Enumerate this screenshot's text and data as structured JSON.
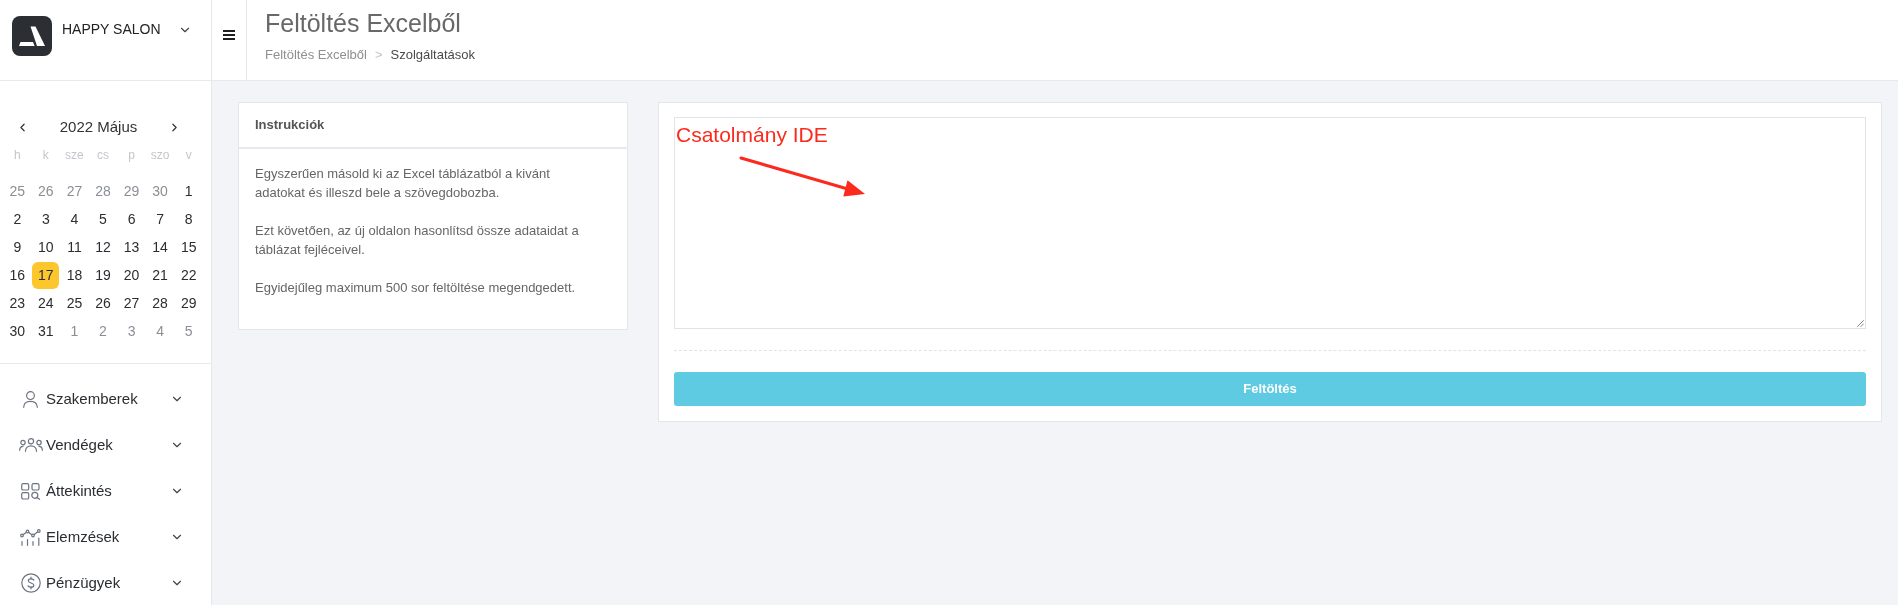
{
  "sidebar": {
    "brand": {
      "name": "HAPPY SALON"
    },
    "calendar": {
      "title": "2022 Május",
      "weekdays": [
        "h",
        "k",
        "sze",
        "cs",
        "p",
        "szo",
        "v"
      ],
      "weeks": [
        [
          {
            "day": "25",
            "outside": true,
            "selected": false
          },
          {
            "day": "26",
            "outside": true,
            "selected": false
          },
          {
            "day": "27",
            "outside": true,
            "selected": false
          },
          {
            "day": "28",
            "outside": true,
            "selected": false
          },
          {
            "day": "29",
            "outside": true,
            "selected": false
          },
          {
            "day": "30",
            "outside": true,
            "selected": false
          },
          {
            "day": "1",
            "outside": false,
            "selected": false
          }
        ],
        [
          {
            "day": "2",
            "outside": false,
            "selected": false
          },
          {
            "day": "3",
            "outside": false,
            "selected": false
          },
          {
            "day": "4",
            "outside": false,
            "selected": false
          },
          {
            "day": "5",
            "outside": false,
            "selected": false
          },
          {
            "day": "6",
            "outside": false,
            "selected": false
          },
          {
            "day": "7",
            "outside": false,
            "selected": false
          },
          {
            "day": "8",
            "outside": false,
            "selected": false
          }
        ],
        [
          {
            "day": "9",
            "outside": false,
            "selected": false
          },
          {
            "day": "10",
            "outside": false,
            "selected": false
          },
          {
            "day": "11",
            "outside": false,
            "selected": false
          },
          {
            "day": "12",
            "outside": false,
            "selected": false
          },
          {
            "day": "13",
            "outside": false,
            "selected": false
          },
          {
            "day": "14",
            "outside": false,
            "selected": false
          },
          {
            "day": "15",
            "outside": false,
            "selected": false
          }
        ],
        [
          {
            "day": "16",
            "outside": false,
            "selected": false
          },
          {
            "day": "17",
            "outside": false,
            "selected": true
          },
          {
            "day": "18",
            "outside": false,
            "selected": false
          },
          {
            "day": "19",
            "outside": false,
            "selected": false
          },
          {
            "day": "20",
            "outside": false,
            "selected": false
          },
          {
            "day": "21",
            "outside": false,
            "selected": false
          },
          {
            "day": "22",
            "outside": false,
            "selected": false
          }
        ],
        [
          {
            "day": "23",
            "outside": false,
            "selected": false
          },
          {
            "day": "24",
            "outside": false,
            "selected": false
          },
          {
            "day": "25",
            "outside": false,
            "selected": false
          },
          {
            "day": "26",
            "outside": false,
            "selected": false
          },
          {
            "day": "27",
            "outside": false,
            "selected": false
          },
          {
            "day": "28",
            "outside": false,
            "selected": false
          },
          {
            "day": "29",
            "outside": false,
            "selected": false
          }
        ],
        [
          {
            "day": "30",
            "outside": false,
            "selected": false
          },
          {
            "day": "31",
            "outside": false,
            "selected": false
          },
          {
            "day": "1",
            "outside": true,
            "selected": false
          },
          {
            "day": "2",
            "outside": true,
            "selected": false
          },
          {
            "day": "3",
            "outside": true,
            "selected": false
          },
          {
            "day": "4",
            "outside": true,
            "selected": false
          },
          {
            "day": "5",
            "outside": true,
            "selected": false
          }
        ]
      ]
    },
    "nav": [
      {
        "label": "Szakemberek",
        "expanded": false
      },
      {
        "label": "Vendégek",
        "expanded": false
      },
      {
        "label": "Áttekintés",
        "expanded": false
      },
      {
        "label": "Elemzések",
        "expanded": false
      },
      {
        "label": "Pénzügyek",
        "expanded": false
      }
    ]
  },
  "header": {
    "title": "Feltöltés Excelből",
    "breadcrumb": {
      "items": [
        "Feltöltés Excelből",
        "Szolgáltatások"
      ],
      "separator": ">"
    }
  },
  "instructions": {
    "title": "Instrukciók",
    "paragraphs": [
      "Egyszerűen másold ki az Excel táblázatból a kivánt adatokat és illeszd bele a szövegdobozba.",
      "Ezt követően, az új oldalon hasonlítsd össze adataidat a táblázat fejléceivel.",
      "Egyidejűleg maximum 500 sor feltöltése megendgedett."
    ]
  },
  "upload": {
    "annotation": "Csatolmány IDE",
    "button": "Feltöltés"
  }
}
